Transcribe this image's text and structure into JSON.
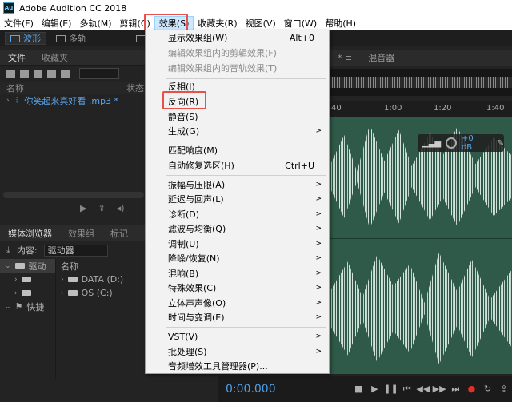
{
  "window": {
    "title": "Adobe Audition CC 2018",
    "app_icon_text": "Au"
  },
  "menubar": {
    "items": [
      {
        "label": "文件(F)"
      },
      {
        "label": "编辑(E)"
      },
      {
        "label": "多轨(M)"
      },
      {
        "label": "剪辑(C)"
      },
      {
        "label": "效果(S)"
      },
      {
        "label": "收藏夹(R)"
      },
      {
        "label": "视图(V)"
      },
      {
        "label": "窗口(W)"
      },
      {
        "label": "帮助(H)"
      }
    ],
    "active_index": 4
  },
  "toolbar": {
    "waveform_label": "波形",
    "multitrack_label": "多轨"
  },
  "files_panel": {
    "tabs": [
      "文件",
      "收藏夹"
    ],
    "columns": {
      "name": "名称",
      "status": "状态"
    },
    "file_name": "你笑起来真好看 .mp3 *"
  },
  "media_panel": {
    "tabs": [
      "媒体浏览器",
      "效果组",
      "标记"
    ],
    "content_label": "内容:",
    "content_value": "驱动器",
    "left_tree": [
      "驱动",
      "快捷"
    ],
    "name_header": "名称",
    "drives": [
      "DATA (D:)",
      "OS (C:)"
    ]
  },
  "editor": {
    "tab_label": "混音器",
    "ruler_labels": [
      "40",
      "1:00",
      "1:20",
      "1:40"
    ],
    "hud_value": "+0 dB"
  },
  "transport": {
    "time": "0:00.000"
  },
  "effects_menu": [
    {
      "label": "显示效果组(W)",
      "shortcut": "Alt+0",
      "enabled": true,
      "submenu": false
    },
    {
      "label": "编辑效果组内的剪辑效果(F)",
      "shortcut": "",
      "enabled": false,
      "submenu": false
    },
    {
      "label": "编辑效果组内的音轨效果(T)",
      "shortcut": "",
      "enabled": false,
      "submenu": false
    },
    {
      "label": "反相(I)",
      "shortcut": "",
      "enabled": true,
      "submenu": false
    },
    {
      "label": "反向(R)",
      "shortcut": "",
      "enabled": true,
      "submenu": false,
      "highlighted": true
    },
    {
      "label": "静音(S)",
      "shortcut": "",
      "enabled": true,
      "submenu": false
    },
    {
      "label": "生成(G)",
      "shortcut": "",
      "enabled": true,
      "submenu": true
    },
    {
      "label": "匹配响度(M)",
      "shortcut": "",
      "enabled": true,
      "submenu": false
    },
    {
      "label": "自动修复选区(H)",
      "shortcut": "Ctrl+U",
      "enabled": true,
      "submenu": false
    },
    {
      "label": "振幅与压限(A)",
      "shortcut": "",
      "enabled": true,
      "submenu": true
    },
    {
      "label": "延迟与回声(L)",
      "shortcut": "",
      "enabled": true,
      "submenu": true
    },
    {
      "label": "诊断(D)",
      "shortcut": "",
      "enabled": true,
      "submenu": true
    },
    {
      "label": "滤波与均衡(Q)",
      "shortcut": "",
      "enabled": true,
      "submenu": true
    },
    {
      "label": "调制(U)",
      "shortcut": "",
      "enabled": true,
      "submenu": true
    },
    {
      "label": "降噪/恢复(N)",
      "shortcut": "",
      "enabled": true,
      "submenu": true
    },
    {
      "label": "混响(B)",
      "shortcut": "",
      "enabled": true,
      "submenu": true
    },
    {
      "label": "特殊效果(C)",
      "shortcut": "",
      "enabled": true,
      "submenu": true
    },
    {
      "label": "立体声声像(O)",
      "shortcut": "",
      "enabled": true,
      "submenu": true
    },
    {
      "label": "时间与变调(E)",
      "shortcut": "",
      "enabled": true,
      "submenu": true
    },
    {
      "label": "VST(V)",
      "shortcut": "",
      "enabled": true,
      "submenu": true
    },
    {
      "label": "批处理(S)",
      "shortcut": "",
      "enabled": true,
      "submenu": true
    },
    {
      "label": "音频增效工具管理器(P)...",
      "shortcut": "",
      "enabled": true,
      "submenu": false
    }
  ],
  "colors": {
    "accent": "#58a6e8",
    "highlight_box": "#e8504a",
    "waveform_bg": "#2f5a49"
  }
}
